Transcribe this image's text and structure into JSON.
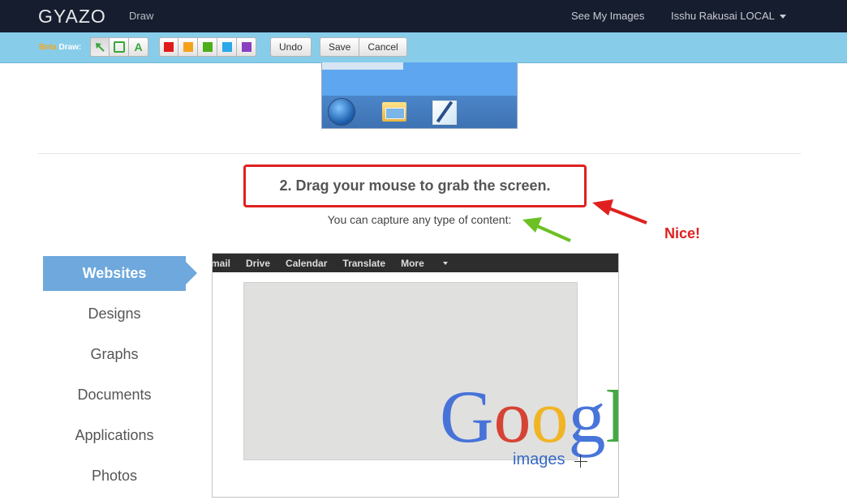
{
  "navbar": {
    "brand": "GYAZO",
    "draw_link": "Draw",
    "see_images": "See My Images",
    "user": "Isshu Rakusai LOCAL"
  },
  "toolbar": {
    "beta": "Beta",
    "draw_label": "Draw:",
    "tools": [
      {
        "name": "arrow-tool",
        "icon": "arrow-icon"
      },
      {
        "name": "rectangle-tool",
        "icon": "rectangle-icon"
      },
      {
        "name": "text-tool",
        "label": "A"
      }
    ],
    "colors": [
      "#e01b1b",
      "#f5a21b",
      "#4caf1a",
      "#2aa8e8",
      "#8a3fc2"
    ],
    "undo": "Undo",
    "save": "Save",
    "cancel": "Cancel"
  },
  "main": {
    "step_title": "2. Drag your mouse to grab the screen.",
    "subtitle": "You can capture any type of content:",
    "annotation": "Nice!",
    "categories": [
      "Websites",
      "Designs",
      "Graphs",
      "Documents",
      "Applications",
      "Photos"
    ],
    "active_category": "Websites"
  },
  "sample": {
    "nav": [
      "mail",
      "Drive",
      "Calendar",
      "Translate",
      "More"
    ],
    "logo_letters": [
      "G",
      "o",
      "o",
      "g",
      "l"
    ],
    "logo_colors": [
      "#3f6ed8",
      "#d63b2b",
      "#f2b21b",
      "#3f6ed8",
      "#3aa53a"
    ],
    "images_label": "images"
  },
  "accent": {
    "annotation_red": "#e02020",
    "annotation_green": "#6cc024",
    "toolbar_bg": "#87cde9",
    "navbar_bg": "#161d2f"
  }
}
